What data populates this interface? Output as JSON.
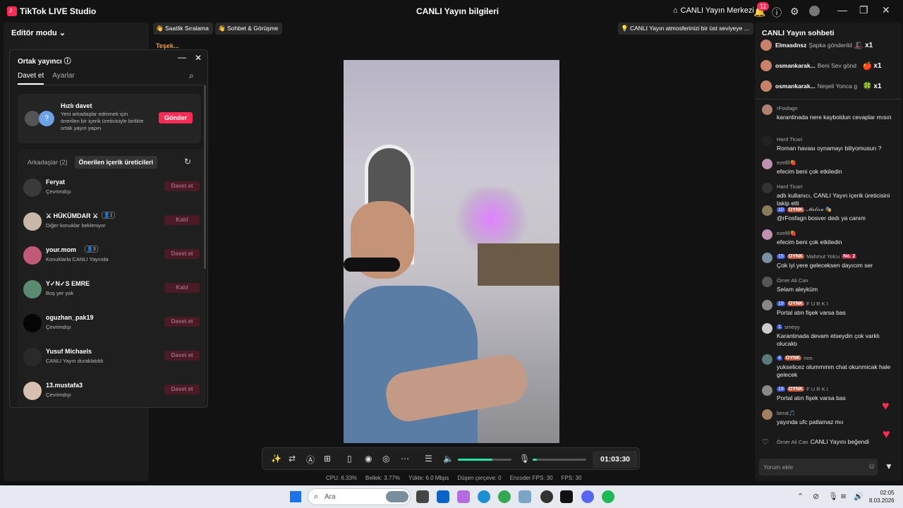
{
  "titlebar": {
    "app_title": "TikTok LIVE Studio",
    "live_info": "CANLI Yayın bilgileri",
    "live_center": "CANLI Yayın Merkezi",
    "notification_count": "11"
  },
  "left": {
    "editor_mode": "Editör modu"
  },
  "popup": {
    "title": "Ortak yayıncı",
    "tab_invite": "Davet et",
    "tab_settings": "Ayarlar",
    "quick_title": "Hızlı davet",
    "quick_desc": "Yeni arkadaşlar edinmek için önerilen bir içerik üreticisiyle birlikte ortak yayın yapın",
    "send": "Gönder",
    "friends_tab": "Arkadaşlar (2)",
    "suggested_tab": "Önerilen içerik üreticileri",
    "people": [
      {
        "name": "Feryat",
        "badge": "",
        "status": "Çevrimdışı",
        "action": "Davet et",
        "color": "#3a3a3a"
      },
      {
        "name": "⚔ HÜKÜMDAR ⚔",
        "badge": "👤1",
        "status": "Diğer konuklar bekleniyor",
        "action": "Katıl",
        "color": "#c9b8a8"
      },
      {
        "name": "your.mom",
        "badge": "👤3",
        "status": "Konuklarla CANLI Yayında",
        "action": "Davet et",
        "color": "#c05a78"
      },
      {
        "name": "Y✓N✓S EMRE",
        "badge": "",
        "status": "Boş yer yok",
        "action": "Katıl",
        "color": "#5a8a70"
      },
      {
        "name": "oguzhan_pak19",
        "badge": "",
        "status": "Çevrimdışı",
        "action": "Davet et",
        "color": "#050505"
      },
      {
        "name": "Yusuf Michaels",
        "badge": "",
        "status": "CANLI Yayın duraklatıldı",
        "action": "Davet et",
        "color": "#2a2a2a"
      },
      {
        "name": "13.mustafa3",
        "badge": "",
        "status": "Çevrimdışı",
        "action": "Davet et",
        "color": "#d8c0b0"
      }
    ]
  },
  "chips": {
    "hourly": "Saatlik Sıralama",
    "chat_meet": "Sohbet & Görüşme",
    "tip": "CANLI Yayın atmosferinizi bir üst seviyeye ...",
    "thanks": "Teşek..."
  },
  "controls": {
    "timer": "01:03:30",
    "volume": 0.65,
    "mic": 0.08
  },
  "stats": {
    "cpu": "CPU:  6.33%",
    "mem": "Bellek:  3.77%",
    "upload": "Yükle:  6.0 Mbps",
    "dropped": "Düşen çerçeve:  0",
    "encoder": "Encoder FPS:  30",
    "fps": "FPS:  30"
  },
  "chat": {
    "title": "CANLI Yayın sohbeti",
    "gifts": [
      {
        "name": "Elmasdnsz",
        "desc": "Şapka gönderildi",
        "icon": "🎩",
        "count": "x1"
      },
      {
        "name": "osmankarak...",
        "desc": "Beni Sev gönd",
        "icon": "🍎",
        "count": "x1"
      },
      {
        "name": "osmankarak...",
        "desc": "Neşeli Yonca g",
        "icon": "🍀",
        "count": "x1"
      }
    ],
    "messages": [
      {
        "user": "rFosfagn",
        "level": "",
        "tag": "",
        "extra": "",
        "text": "karantinada nere kayboldun cevaplar mısın",
        "color": "#b08070"
      },
      {
        "user": "Hard Ticari",
        "level": "",
        "tag": "",
        "extra": "",
        "text": "Roman havası oynamayı biliyomusun ?",
        "color": "#222"
      },
      {
        "user": "ezellll🍓",
        "level": "",
        "tag": "",
        "extra": "",
        "text": "efecim beni çok etkiledin",
        "color": "#c090b0"
      },
      {
        "user": "Hard Ticari",
        "level": "",
        "tag": "",
        "extra": "",
        "text": "adlı kullanıcı, CANLI Yayın içerik üreticisini takip etti",
        "color": "#333"
      },
      {
        "user": "𝓜𝓮𝓵𝓲𝓼𝓪 🎭",
        "level": "10",
        "tag": "OYNK",
        "extra": "",
        "text": "@rFosfagn bosver dedı ya canım",
        "color": "#8a7a5a"
      },
      {
        "user": "ezellll🍓",
        "level": "",
        "tag": "",
        "extra": "",
        "text": "efecim beni çok etkiledin",
        "color": "#c090b0"
      },
      {
        "user": "Mahmut Yolcu",
        "level": "15",
        "tag": "OYNK",
        "extra": "No. 2",
        "text": "Çok iyi yere geleceksen dayıcım ser",
        "color": "#7a90a0"
      },
      {
        "user": "Ömer Ali Can",
        "level": "",
        "tag": "",
        "extra": "",
        "text": "Selam aleyküm",
        "color": "#555"
      },
      {
        "user": "F U R K I",
        "level": "19",
        "tag": "OYNK",
        "extra": "",
        "text": "Portal atın fişek varsa bas",
        "color": "#888"
      },
      {
        "user": "smeyy",
        "level": "1",
        "tag": "",
        "extra": "",
        "text": "Karantinada devam etseydin çok varklı olucaktı",
        "color": "#ccc"
      },
      {
        "user": "mm",
        "level": "4",
        "tag": "OYNK",
        "extra": "",
        "text": "yukselicez olummmm chat okunmicak hale gelecek",
        "color": "#5a7a7a"
      },
      {
        "user": "F U R K I",
        "level": "19",
        "tag": "OYNK",
        "extra": "",
        "text": "Portal atın fişek varsa bas",
        "color": "#888"
      },
      {
        "user": "berat🎵",
        "level": "",
        "tag": "",
        "extra": "",
        "text": "yayında ufc patlamaz mıı",
        "color": "#a08060"
      }
    ],
    "liked_user": "Ömer Ali Can",
    "liked_text": "CANLI Yayını beğendi",
    "input_placeholder": "Yorum ekle"
  },
  "taskbar": {
    "search_placeholder": "Ara",
    "time": "02:05",
    "date": "8.03.2026"
  }
}
